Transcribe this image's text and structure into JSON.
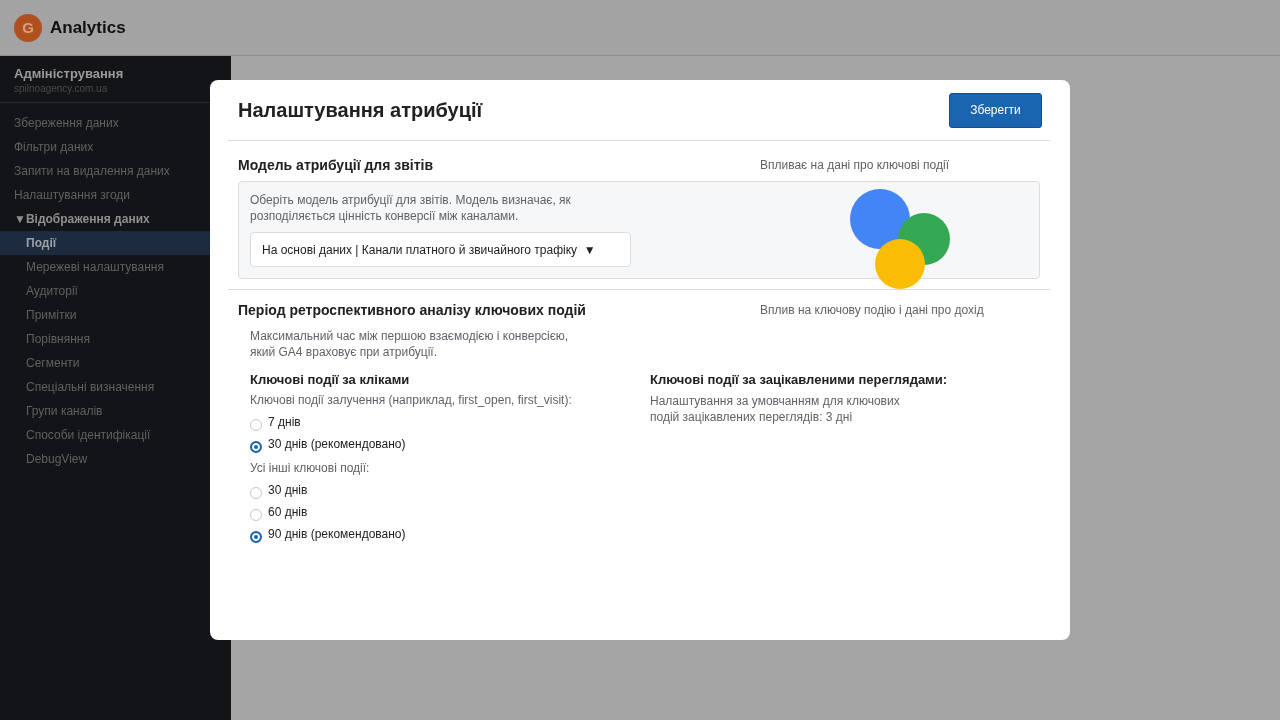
{
  "app": {
    "logo_letter": "G",
    "title": "Analytics"
  },
  "sidebar": {
    "title": "Адміністрування",
    "subtitle": "spilnoagency.com.ua",
    "items": [
      {
        "label": "Збереження даних",
        "selected": false
      },
      {
        "label": "Фільтри даних",
        "selected": false
      },
      {
        "label": "Запити на видалення даних",
        "selected": false
      },
      {
        "label": "Налаштування згоди",
        "selected": false
      },
      {
        "label": "Відображення даних",
        "selected": false,
        "expanded": true,
        "toggle": "▼",
        "children": [
          {
            "label": "Події",
            "selected": true
          },
          {
            "label": "Мережеві налаштування",
            "selected": false
          },
          {
            "label": "Аудиторії",
            "selected": false
          },
          {
            "label": "Примітки",
            "selected": false
          },
          {
            "label": "Порівняння",
            "selected": false
          },
          {
            "label": "Сегменти",
            "selected": false
          },
          {
            "label": "Спеціальні визначення",
            "selected": false
          },
          {
            "label": "Групи каналів",
            "selected": false
          },
          {
            "label": "Способи ідентифікації",
            "selected": false
          },
          {
            "label": "DebugView",
            "selected": false
          }
        ]
      }
    ]
  },
  "dialog": {
    "title": "Налаштування атрибуції",
    "save_button": "Зберегти",
    "model_section": {
      "title": "Модель атрибуції для звітів",
      "note": "Впливає на дані про ключові події",
      "description": "Оберіть модель атрибуції для звітів. Модель визначає, як розподіляється цінність конверсії між каналами.",
      "dropdown": {
        "value": "На основі даних | Канали платного й звичайного трафіку",
        "caret": "▼"
      }
    },
    "lookback_section": {
      "title": "Період ретроспективного аналізу ключових подій",
      "note": "Вплив на ключову подію і дані про дохід",
      "description": "Максимальний час між першою взаємодією і конверсією, який GA4 враховує при атрибуції.",
      "clicks": {
        "title": "Ключові події за кліками",
        "groups": [
          {
            "label": "Ключові події залучення (наприклад, first_open, first_visit):",
            "options": [
              {
                "label": "7 днів",
                "selected": false
              },
              {
                "label": "30 днів (рекомендовано)",
                "selected": true
              }
            ]
          },
          {
            "label": "Усі інші ключові події:",
            "options": [
              {
                "label": "30 днів",
                "selected": false
              },
              {
                "label": "60 днів",
                "selected": false
              },
              {
                "label": "90 днів (рекомендовано)",
                "selected": true
              }
            ]
          }
        ]
      },
      "views": {
        "title": "Ключові події за зацікавленими переглядами:",
        "text": "Налаштування за умовчанням для ключових подій зацікавлених переглядів: 3 дні"
      }
    }
  }
}
